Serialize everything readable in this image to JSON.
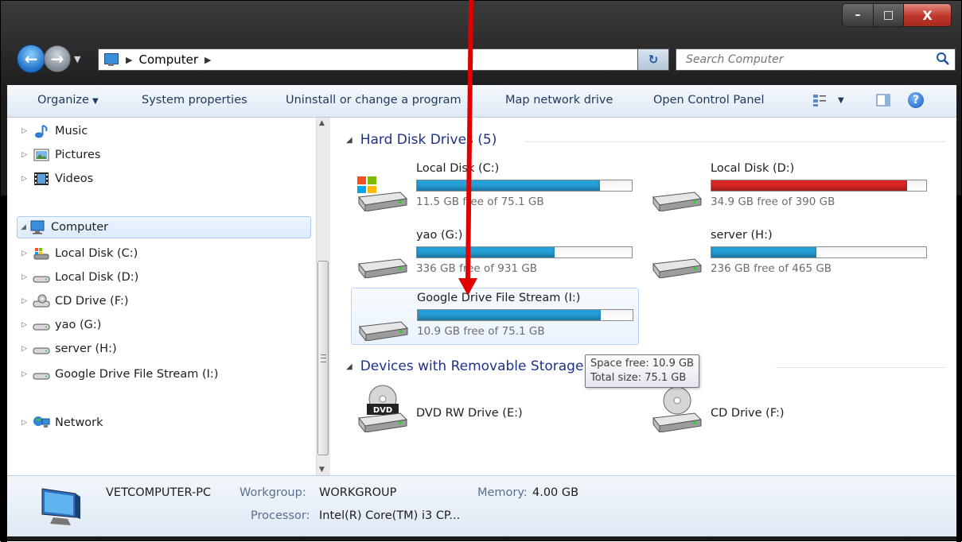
{
  "window": {
    "buttons": {
      "minimize": "–",
      "maximize": "□",
      "close": "X"
    }
  },
  "address": {
    "crumb": "Computer",
    "search_placeholder": "Search Computer"
  },
  "toolbar": {
    "organize": "Organize",
    "system_properties": "System properties",
    "uninstall": "Uninstall or change a program",
    "map_drive": "Map network drive",
    "control_panel": "Open Control Panel"
  },
  "sidebar": {
    "libraries": [
      {
        "label": "Music",
        "icon": "music-icon"
      },
      {
        "label": "Pictures",
        "icon": "pictures-icon"
      },
      {
        "label": "Videos",
        "icon": "videos-icon"
      }
    ],
    "computer": {
      "label": "Computer",
      "icon": "computer-icon"
    },
    "drives": [
      {
        "label": "Local Disk (C:)",
        "icon": "windows-drive-icon"
      },
      {
        "label": "Local Disk (D:)",
        "icon": "drive-icon"
      },
      {
        "label": "CD Drive (F:)",
        "icon": "cd-drive-icon"
      },
      {
        "label": "yao (G:)",
        "icon": "drive-icon"
      },
      {
        "label": "server (H:)",
        "icon": "drive-icon"
      },
      {
        "label": "Google Drive File Stream (I:)",
        "icon": "drive-icon"
      }
    ],
    "network": {
      "label": "Network",
      "icon": "network-icon"
    }
  },
  "content": {
    "hdd_header": "Hard Disk Drives (5)",
    "removable_header": "Devices with Removable Storage (2)",
    "drives": [
      {
        "name": "Local Disk (C:)",
        "free": "11.5 GB free of 75.1 GB",
        "used_fraction": 0.85,
        "color": "#26a0da"
      },
      {
        "name": "Local Disk (D:)",
        "free": "34.9 GB free of 390 GB",
        "used_fraction": 0.91,
        "color": "#da2626"
      },
      {
        "name": "yao (G:)",
        "free": "336 GB free of 931 GB",
        "used_fraction": 0.64,
        "color": "#26a0da"
      },
      {
        "name": "server (H:)",
        "free": "236 GB free of 465 GB",
        "used_fraction": 0.49,
        "color": "#26a0da"
      },
      {
        "name": "Google Drive File Stream (I:)",
        "free": "10.9 GB free of 75.1 GB",
        "used_fraction": 0.85,
        "color": "#26a0da"
      }
    ],
    "removable": [
      {
        "name": "DVD RW Drive (E:)",
        "badge": "DVD"
      },
      {
        "name": "CD Drive (F:)"
      }
    ],
    "tooltip": {
      "line1": "Space free: 10.9 GB",
      "line2": "Total size: 75.1 GB"
    }
  },
  "details": {
    "pc_name": "VETCOMPUTER-PC",
    "workgroup_label": "Workgroup:",
    "workgroup_value": "WORKGROUP",
    "memory_label": "Memory:",
    "memory_value": "4.00 GB",
    "processor_label": "Processor:",
    "processor_value": "Intel(R) Core(TM) i3 CP..."
  },
  "annotation": {
    "color": "#e00000"
  }
}
